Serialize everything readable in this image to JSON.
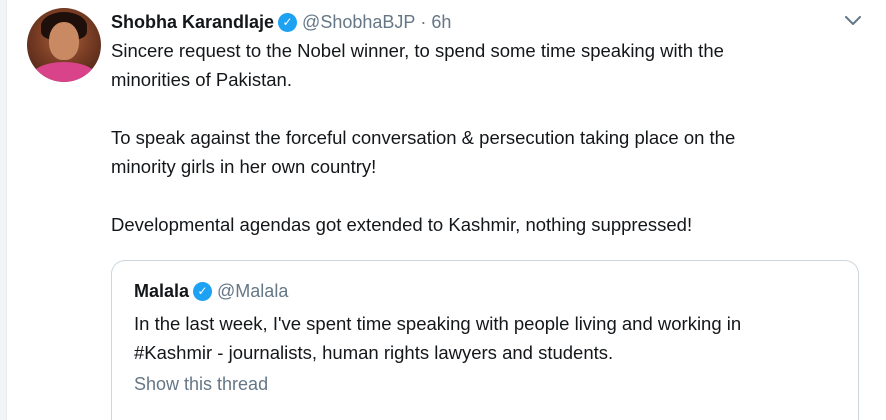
{
  "tweet": {
    "author_name": "Shobha Karandlaje",
    "author_handle": "@ShobhaBJP",
    "separator": "·",
    "time": "6h",
    "verified_icon": "verified-badge-icon",
    "menu_icon": "chevron-down-icon",
    "lines": [
      "Sincere request to the Nobel winner, to spend some time speaking with the",
      "minorities of Pakistan.",
      "",
      "To speak against the forceful conversation & persecution taking place on the",
      "minority girls in her own country!",
      "",
      "Developmental agendas got extended to Kashmir, nothing suppressed!"
    ]
  },
  "quoted_tweet": {
    "author_name": "Malala",
    "author_handle": "@Malala",
    "lines": [
      "In the last week, I've spent time speaking with people living and working in",
      "#Kashmir - journalists, human rights lawyers and students."
    ],
    "show_thread_label": "Show this thread"
  },
  "colors": {
    "verified": "#1da1f2",
    "secondary_text": "#657786",
    "border": "#ccd6dd"
  }
}
